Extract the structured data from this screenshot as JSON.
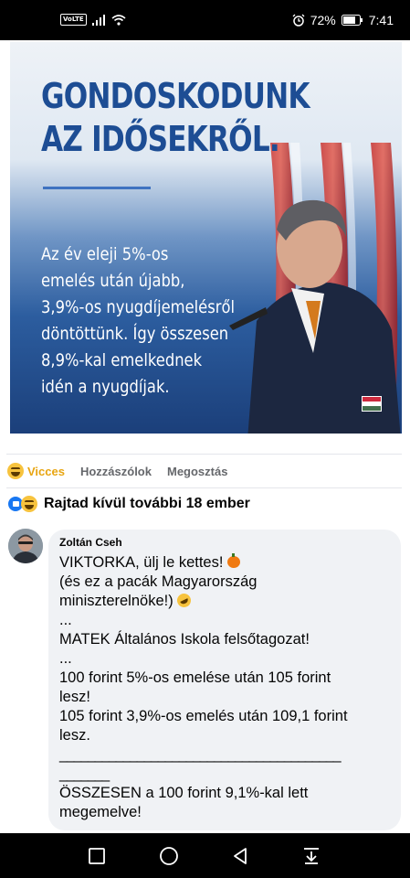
{
  "status_bar": {
    "network_badge": "VoLTE",
    "battery_percent": "72%",
    "time": "7:41",
    "icons": [
      "signal-icon",
      "wifi-icon",
      "alarm-icon",
      "battery-icon"
    ]
  },
  "post_image": {
    "headline_lines": [
      "GONDOSKODUNK",
      "AZ IDŐSEKRŐL."
    ],
    "body_lines": [
      "Az év eleji 5%-os",
      "emelés után újabb,",
      "3,9%-os nyugdíjemelésről",
      "döntöttünk. Így összesen",
      "8,9%-kal emelkednek",
      "idén a nyugdíjak."
    ],
    "colors": {
      "headline": "#1d4d94",
      "accent_rule": "#3f73c0",
      "background_bottom": "#1b3f7a"
    }
  },
  "actions": {
    "reaction_label": "Vicces",
    "comment_label": "Hozzászólok",
    "share_label": "Megosztás"
  },
  "reactions_summary": {
    "text": "Rajtad kívül további 18 ember",
    "icons": [
      "like-icon",
      "haha-icon"
    ]
  },
  "comment": {
    "author": "Zoltán Cseh",
    "lines": [
      "VIKTORKA, ülj le kettes!",
      "(és ez a pacák Magyarország",
      "miniszterelnöke!)",
      "...",
      "MATEK Általános Iskola felsőtagozat!",
      "...",
      "100 forint 5%-os emelése után 105 forint",
      "lesz!",
      "105 forint 3,9%-os emelés után 109,1 forint",
      "lesz.",
      "________________________________________",
      "_______",
      "ÖSSZESEN a 100 forint 9,1%-kal lett",
      "megemelve!"
    ]
  },
  "nav_bar": {
    "buttons": [
      "square-icon",
      "circle-icon",
      "back-triangle-icon",
      "download-arrow-icon"
    ]
  }
}
